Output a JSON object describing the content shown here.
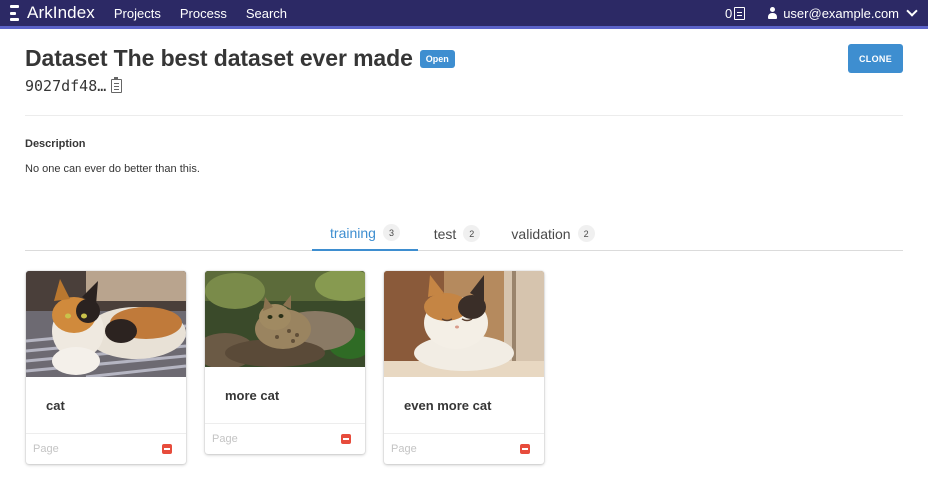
{
  "navbar": {
    "brand": "ArkIndex",
    "links": [
      "Projects",
      "Process",
      "Search"
    ],
    "count": "0",
    "user": "user@example.com"
  },
  "header": {
    "title": "Dataset The best dataset ever made",
    "status": "Open",
    "dataset_id": "9027df48…",
    "clone_label": "CLONE"
  },
  "description": {
    "heading": "Description",
    "text": "No one can ever do better than this."
  },
  "tabs": [
    {
      "label": "training",
      "count": "3"
    },
    {
      "label": "test",
      "count": "2"
    },
    {
      "label": "validation",
      "count": "2"
    }
  ],
  "cards": [
    {
      "title": "cat",
      "page_label": "Page"
    },
    {
      "title": "more cat",
      "page_label": "Page"
    },
    {
      "title": "even more cat",
      "page_label": "Page"
    }
  ],
  "colors": {
    "navbar": "#2c2965",
    "accent": "#3e8ed0",
    "danger": "#e74c3c"
  }
}
